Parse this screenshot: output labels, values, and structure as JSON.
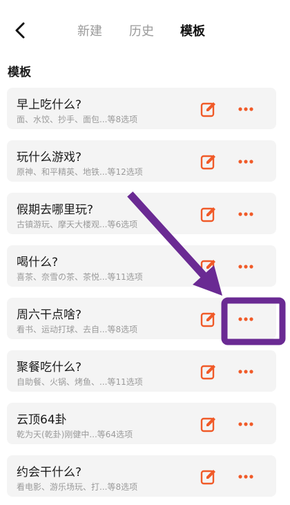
{
  "header": {
    "tabs": [
      {
        "label": "新建"
      },
      {
        "label": "历史"
      },
      {
        "label": "模板"
      }
    ]
  },
  "section": {
    "title": "模板"
  },
  "templates": [
    {
      "title": "早上吃什么?",
      "subtitle": "面、水饺、抄手、面包...等8选项"
    },
    {
      "title": "玩什么游戏?",
      "subtitle": "原神、和平精英、地铁...等12选项"
    },
    {
      "title": "假期去哪里玩?",
      "subtitle": "古镇游玩、摩天大楼观...等6选项"
    },
    {
      "title": "喝什么?",
      "subtitle": "喜茶、奈雪の茶、茶悦...等11选项"
    },
    {
      "title": "周六干点啥?",
      "subtitle": "看书、运动打球、去自...等8选项"
    },
    {
      "title": "聚餐吃什么?",
      "subtitle": "自助餐、火锅、烤鱼、...等11选项"
    },
    {
      "title": "云顶64卦",
      "subtitle": "乾为天(乾卦)刚健中...等64选项"
    },
    {
      "title": "约会干什么?",
      "subtitle": "看电影、游乐场玩、打...等8选项"
    }
  ],
  "colors": {
    "accent": "#f05a28",
    "annotation": "#6a2a93",
    "card_bg": "#f4f4f4"
  },
  "icons": {
    "back": "chevron-left-icon",
    "edit": "edit-icon",
    "more": "more-dots-icon"
  }
}
